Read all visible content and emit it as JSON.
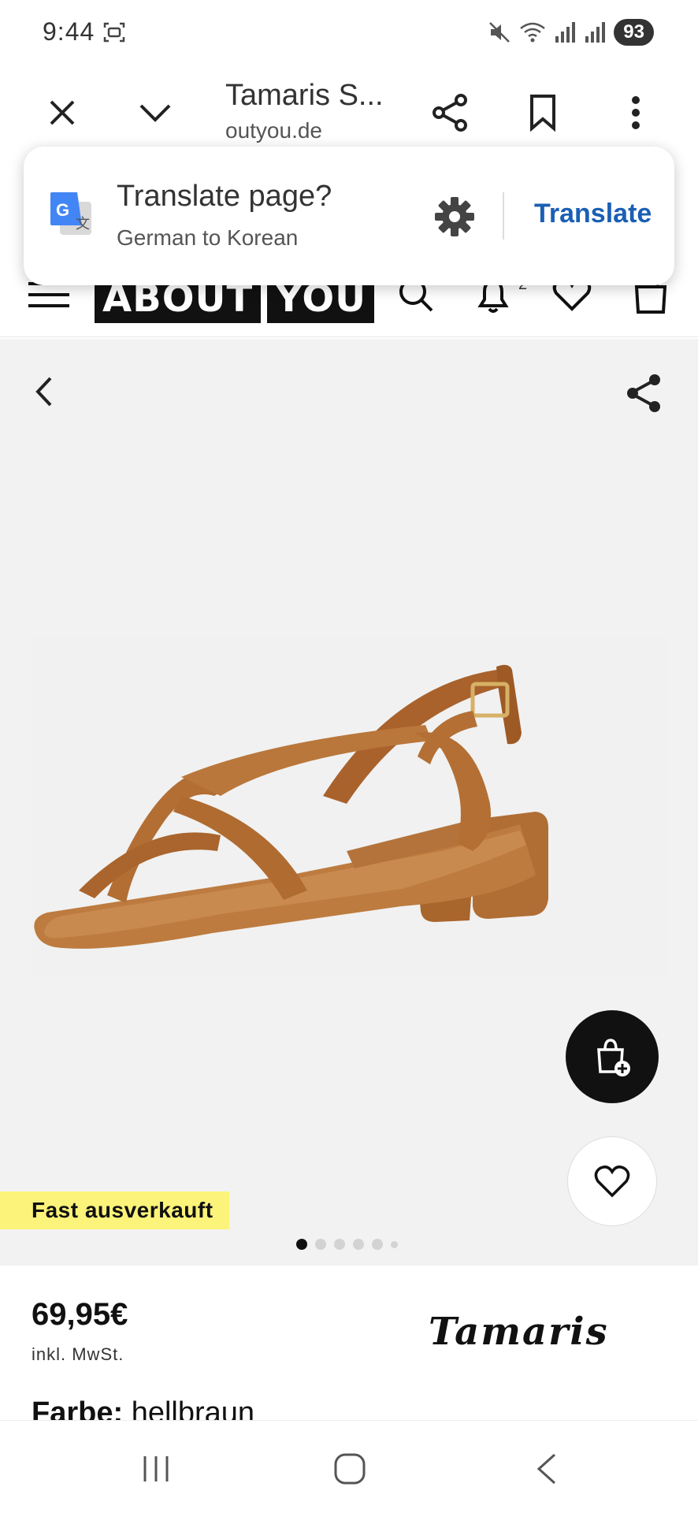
{
  "status_bar": {
    "time": "9:44",
    "battery": "93"
  },
  "toolbar": {
    "title": "Tamaris S...",
    "url": "outyou.de"
  },
  "translate_popup": {
    "title": "Translate page?",
    "subtitle": "German to Korean",
    "action_label": "Translate",
    "accent": "#1a5fb4"
  },
  "site_header": {
    "logo_part1": "ABOUT",
    "logo_part2": "YOU",
    "notification_count": "2"
  },
  "gallery": {
    "badge": "Fast ausverkauft",
    "badge_color": "#fcf47a",
    "image_count": 6,
    "active_image": 1
  },
  "product": {
    "price": "69,95€",
    "tax_note": "inkl. MwSt.",
    "brand": "Tamaris",
    "color_label": "Farbe:",
    "color_value": "hellbraun"
  }
}
